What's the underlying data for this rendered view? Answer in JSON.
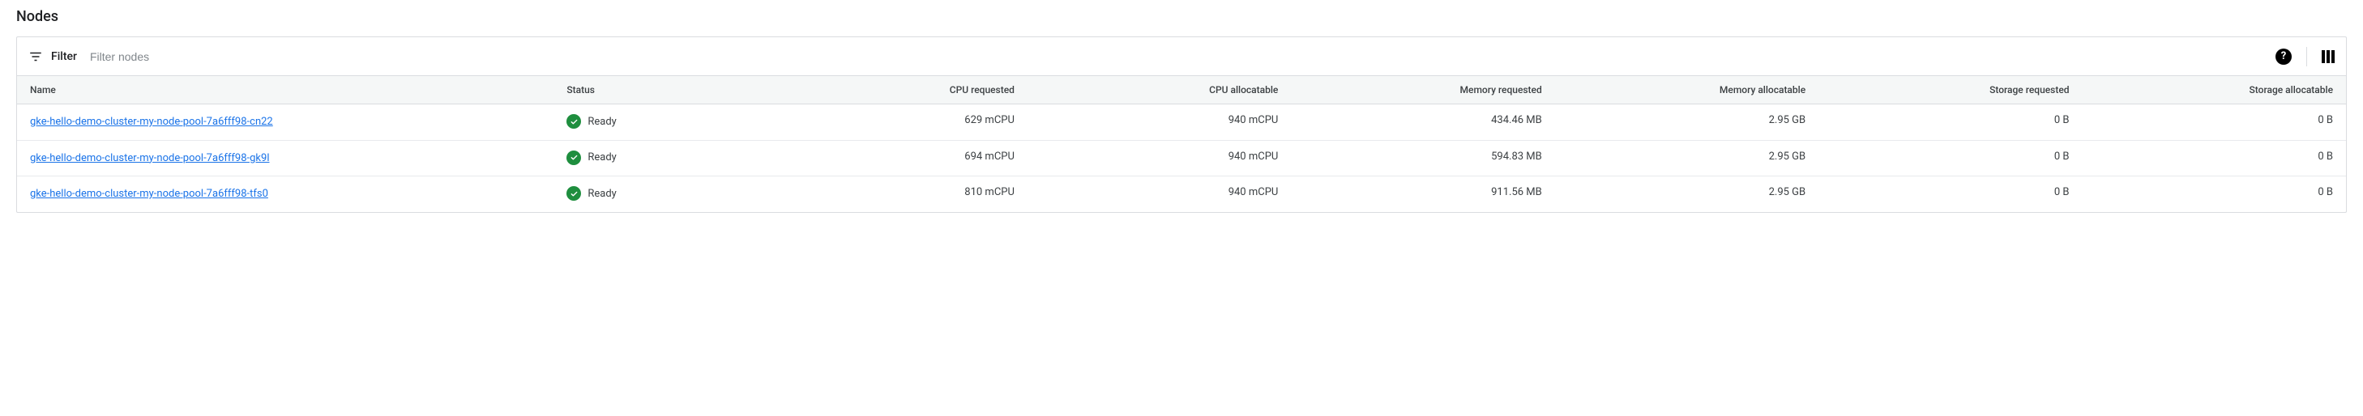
{
  "title": "Nodes",
  "filter": {
    "label": "Filter",
    "placeholder": "Filter nodes"
  },
  "columns": {
    "name": "Name",
    "status": "Status",
    "cpu_requested": "CPU requested",
    "cpu_allocatable": "CPU allocatable",
    "memory_requested": "Memory requested",
    "memory_allocatable": "Memory allocatable",
    "storage_requested": "Storage requested",
    "storage_allocatable": "Storage allocatable"
  },
  "status_colors": {
    "ready": "#1e8e3e"
  },
  "rows": [
    {
      "name": "gke-hello-demo-cluster-my-node-pool-7a6fff98-cn22",
      "status": "Ready",
      "cpu_requested": "629 mCPU",
      "cpu_allocatable": "940 mCPU",
      "memory_requested": "434.46 MB",
      "memory_allocatable": "2.95 GB",
      "storage_requested": "0 B",
      "storage_allocatable": "0 B"
    },
    {
      "name": "gke-hello-demo-cluster-my-node-pool-7a6fff98-gk9l",
      "status": "Ready",
      "cpu_requested": "694 mCPU",
      "cpu_allocatable": "940 mCPU",
      "memory_requested": "594.83 MB",
      "memory_allocatable": "2.95 GB",
      "storage_requested": "0 B",
      "storage_allocatable": "0 B"
    },
    {
      "name": "gke-hello-demo-cluster-my-node-pool-7a6fff98-tfs0",
      "status": "Ready",
      "cpu_requested": "810 mCPU",
      "cpu_allocatable": "940 mCPU",
      "memory_requested": "911.56 MB",
      "memory_allocatable": "2.95 GB",
      "storage_requested": "0 B",
      "storage_allocatable": "0 B"
    }
  ]
}
